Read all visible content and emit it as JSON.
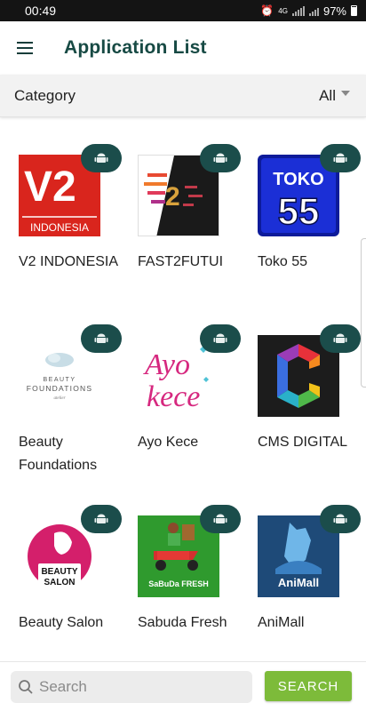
{
  "status_bar": {
    "time": "00:49",
    "network": "4G",
    "battery": "97%"
  },
  "app_bar": {
    "title": "Application List",
    "menu_icon": "hamburger-menu-icon"
  },
  "category": {
    "label": "Category",
    "selected": "All"
  },
  "apps": [
    {
      "name": "V2 INDONESIA",
      "platform": "android",
      "logo_text": "V2",
      "logo_sub": "INDONESIA"
    },
    {
      "name": "FAST2FUTUI",
      "platform": "android",
      "logo_text": "2"
    },
    {
      "name": "Toko 55",
      "platform": "android",
      "logo_text": "TOKO",
      "logo_sub": "55"
    },
    {
      "name": "Beauty Foundations",
      "platform": "android",
      "logo_text": "BEAUTY",
      "logo_sub": "FOUNDATIONS",
      "logo_note": "atelier"
    },
    {
      "name": "Ayo Kece",
      "platform": "android",
      "logo_text": "Ayo",
      "logo_sub": "kece"
    },
    {
      "name": "CMS DIGITAL",
      "platform": "android",
      "logo_text": "C"
    },
    {
      "name": "Beauty Salon",
      "platform": "android",
      "logo_text": "BEAUTY",
      "logo_sub": "SALON"
    },
    {
      "name": "Sabuda Fresh",
      "platform": "android",
      "logo_text": "SaBuDa FRESH"
    },
    {
      "name": "AniMall",
      "platform": "android",
      "logo_text": "AniMall"
    }
  ],
  "search": {
    "placeholder": "Search",
    "value": "",
    "button_label": "SEARCH"
  },
  "colors": {
    "primary": "#174a44",
    "badge": "#1b4d4b",
    "accent": "#7dbb3a",
    "status_bar": "#141414"
  }
}
